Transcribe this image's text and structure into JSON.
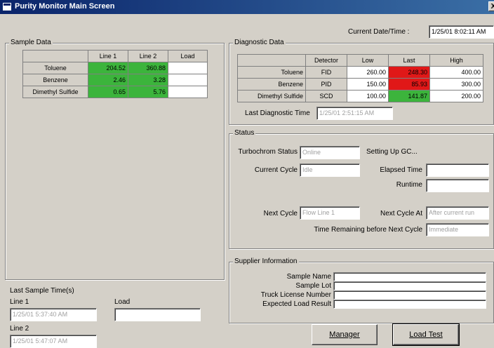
{
  "window": {
    "title": "Purity Monitor Main Screen",
    "close_label": "X"
  },
  "header": {
    "datetime_label": "Current Date/Time :",
    "datetime_value": "1/25/01 8:02:11 AM"
  },
  "sample_data": {
    "title": "Sample Data",
    "columns": [
      "",
      "Line 1",
      "Line 2",
      "Load"
    ],
    "rows": [
      {
        "name": "Toluene",
        "line1": "204.52",
        "line2": "360.88",
        "load": ""
      },
      {
        "name": "Benzene",
        "line1": "2.46",
        "line2": "3.28",
        "load": ""
      },
      {
        "name": "Dimethyl Sulfide",
        "line1": "0.65",
        "line2": "5.76",
        "load": ""
      }
    ],
    "last_sample_label": "Last Sample Time(s)",
    "line1_label": "Line 1",
    "line1_value": "1/25/01 5:37:40 AM",
    "load_label": "Load",
    "load_value": "",
    "line2_label": "Line 2",
    "line2_value": "1/25/01 5:47:07 AM"
  },
  "diagnostic_data": {
    "title": "Diagnostic Data",
    "columns": [
      "",
      "Detector",
      "Low",
      "Last",
      "High"
    ],
    "rows": [
      {
        "name": "Toluene",
        "detector": "FID",
        "low": "260.00",
        "last": "248.30",
        "high": "400.00",
        "status": "red"
      },
      {
        "name": "Benzene",
        "detector": "PID",
        "low": "150.00",
        "last": "85.93",
        "high": "300.00",
        "status": "red"
      },
      {
        "name": "Dimethyl Sulfide",
        "detector": "SCD",
        "low": "100.00",
        "last": "141.87",
        "high": "200.00",
        "status": "green"
      }
    ],
    "last_time_label": "Last Diagnostic Time",
    "last_time_value": "1/25/01 2:51:15 AM"
  },
  "status": {
    "title": "Status",
    "turbochrom_label": "Turbochrom Status",
    "turbochrom_value": "Online",
    "setting_up": "Setting Up GC...",
    "current_cycle_label": "Current Cycle",
    "current_cycle_value": "Idle",
    "elapsed_label": "Elapsed Time",
    "elapsed_value": "",
    "runtime_label": "Runtime",
    "runtime_value": "",
    "next_cycle_label": "Next Cycle",
    "next_cycle_value": "Flow Line 1",
    "next_cycle_at_label": "Next Cycle At",
    "next_cycle_at_value": "After current run",
    "time_remaining_label": "Time Remaining before Next Cycle",
    "time_remaining_value": "Immediate"
  },
  "supplier": {
    "title": "Supplier Information",
    "fields": [
      {
        "label": "Sample Name",
        "value": ""
      },
      {
        "label": "Sample Lot",
        "value": ""
      },
      {
        "label": "Truck License Number",
        "value": ""
      },
      {
        "label": "Expected Load Result",
        "value": ""
      }
    ]
  },
  "buttons": {
    "manager": "Manager",
    "load_test": "Load Test"
  },
  "colors": {
    "titlebar": "#0a246a",
    "ok": "#3cb43c",
    "alarm": "#e01818",
    "panel": "#d4d0c8"
  }
}
